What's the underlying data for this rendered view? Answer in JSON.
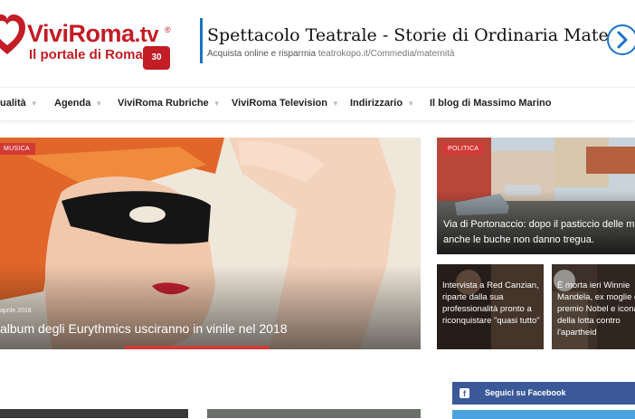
{
  "header": {
    "logo_name": "ViviRoma",
    "logo_tld": ".tv",
    "logo_reg": "®",
    "logo_tagline": "Il portale di Roma",
    "logo_badge": "30",
    "brand_color": "#c21d25"
  },
  "ad": {
    "title": "Spettacolo Teatrale - Storie di Ordinaria Maternità",
    "subtitle": "Acquista online e risparmia",
    "url": "teatrokopo.it/Commedia/maternità",
    "accent_color": "#1a73c9",
    "arrow_icon": "chevron-right-icon"
  },
  "nav": {
    "items": [
      {
        "label": "ualità"
      },
      {
        "label": "Agenda"
      },
      {
        "label": "ViviRoma Rubriche"
      },
      {
        "label": "ViviRoma Television"
      },
      {
        "label": "Indirizzario"
      },
      {
        "label": "Il blog di Massimo Marino"
      }
    ]
  },
  "hero": {
    "category": "MUSICA",
    "date": "aprile 2018",
    "title": "album degli Eurythmics usciranno in vinile nel 2018"
  },
  "side_big": {
    "category": "POLITICA",
    "title": "Via di Portonaccio: dopo il pasticcio delle multe anche le buche non danno tregua."
  },
  "small_cards": [
    {
      "title": "Intervista a Red Canzian, riparte dalla sua professionalità pronto a riconquistare \"quasi tutto\""
    },
    {
      "title": "È morta ieri Winnie Mandela, ex moglie di premio Nobel e icona della lotta contro l'apartheid"
    }
  ],
  "social": {
    "facebook_label": "Seguici su Facebook",
    "facebook_color": "#3b5998",
    "twitter_color": "#4aa3df"
  },
  "colors": {
    "category_badge": "#d23a36"
  }
}
